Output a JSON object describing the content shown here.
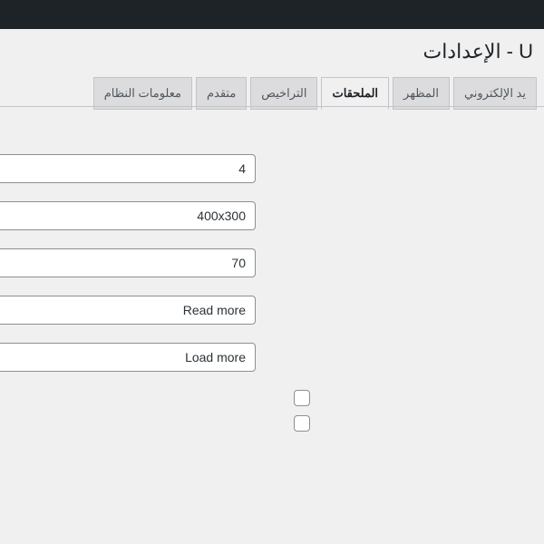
{
  "header": {
    "title_fragment": "U - الإعدادات"
  },
  "tabs": {
    "item0": "يد الإلكتروني",
    "item1": "المظهر",
    "item2": "الملحقات",
    "item3": "التراخيص",
    "item4": "متقدم",
    "item5": "معلومات النظام",
    "active_index": 2
  },
  "form": {
    "field_count": "4",
    "field_size": "400x300",
    "field_quality": "70",
    "field_readmore": "Read more",
    "field_loadmore": "Load more",
    "checkbox1": false,
    "checkbox2": false
  }
}
